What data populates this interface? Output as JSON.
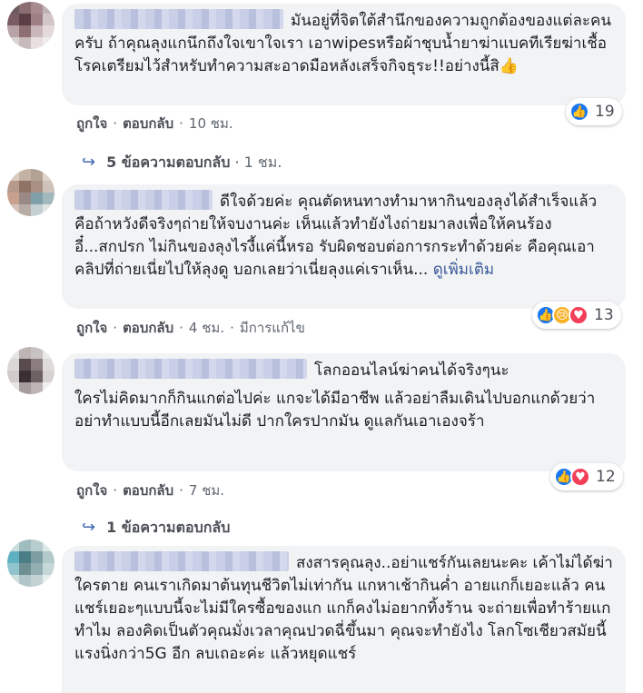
{
  "comments": [
    {
      "text": "มันอยู่ที่จิตใต้สำนึกของความถูกต้องของแต่ละคนครับ ถ้าคุณลุงแกนึกถึงใจเขาใจเรา เอาwipesหรือผ้าชุบน้ำยาฆ่าแบคทีเรียฆ่าเชื้อโรคเตรียมไว้สำหรับทำความสะอาดมือหลังเสร็จกิจธุระ!!อย่างนี้สิ👍",
      "like": "ถูกใจ",
      "reply": "ตอบกลับ",
      "time": "10 ชม.",
      "reaction_count": "19",
      "reactions": [
        "like-icon"
      ],
      "replies_label": "5 ข้อความตอบกลับ",
      "replies_time": "1 ชม."
    },
    {
      "text": "ดีใจด้วยค่ะ คุณตัดหนทางทำมาหากินของลุงได้สำเร็จแล้ว คือถ้าหวังดีจริงๆถ่ายให้จบงานค่ะ เห็นแล้วทำยังไงถ่ายมาลงเพื่อให้คนร้องอี๋...สกปรก ไม่กินของลุงไรงี้แค่นี้หรอ รับผิดชอบต่อการกระทำด้วยค่ะ คือคุณเอาคลิปที่ถ่ายเนี่ยไปให้ลุงดู บอกเลยว่าเนี่ยลุงแค่เราเห็น...",
      "more": "ดูเพิ่มเติม",
      "like": "ถูกใจ",
      "reply": "ตอบกลับ",
      "time": "4 ชม.",
      "edited": "มีการแก้ไข",
      "reaction_count": "13",
      "reactions": [
        "like-icon",
        "sad-icon",
        "love-icon"
      ]
    },
    {
      "text_line1": "โลกออนไลน์ฆ่าคนได้จริงๆนะ",
      "text_rest": "ใครไม่คิดมากก็กินแกต่อไปค่ะ แกจะได้มีอาชีพ แล้วอย่าลืมเดินไปบอกแกด้วยว่าอย่าทำแบบนี้อีกเลยมันไม่ดี ปากใครปากมัน ดูแลกันเอาเองจร้า",
      "reply": "ตอบกลับ",
      "time": "7 ชม.",
      "reaction_count": "12",
      "reactions": [
        "like-icon",
        "love-icon"
      ],
      "replies_label": "1 ข้อความตอบกลับ"
    },
    {
      "text": "สงสารคุณลุง..อย่าแชร์กันเลยนะคะ เค้าไม่ได้ฆ่าใครตาย คนเราเกิดมาต้นทุนชีวิตไม่เท่ากัน แกหาเช้ากินค่ำ อายแกก็เยอะแล้ว คนแชร์เยอะๆแบบนี้จะไม่มีใครซื้อของแก แกก็คงไม่อยากทิ้งร้าน จะถ่ายเพื่อทำร้ายแกทำไม ลองคิดเป็นตัวคุณมั่งเวลาคุณปวดฉี่ขึ้นมา คุณจะทำยังไง โลกโซเชียวสมัยนี้แรงนิ่งกว่า5G อีก ลบเถอะค่ะ แล้วหยุดแชร์"
    }
  ],
  "colors": {
    "bubble": "#f2f3f5",
    "link": "#385898",
    "like": "#1877f2",
    "love": "#f33e58",
    "sad": "#f7b125"
  }
}
